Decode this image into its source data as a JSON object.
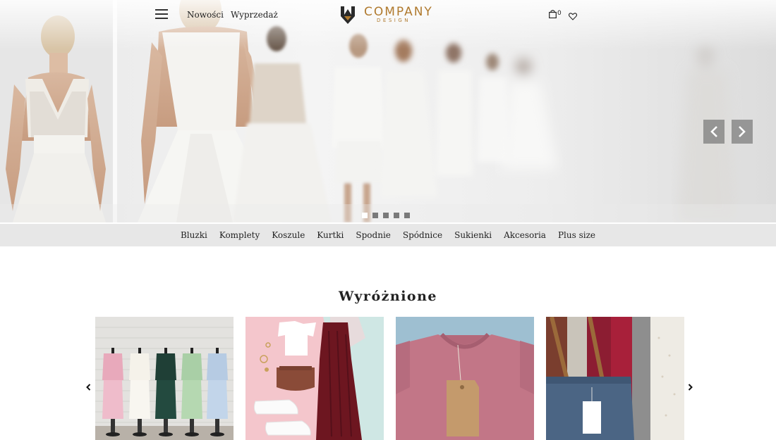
{
  "header": {
    "nav": [
      "Nowości",
      "Wyprzedaż"
    ],
    "logo_main": "COMPANY",
    "logo_sub": "DESIGN",
    "cart_count": "0"
  },
  "hero": {
    "slides_total": 5,
    "active_slide": 1
  },
  "categories": [
    "Bluzki",
    "Komplety",
    "Koszule",
    "Kurtki",
    "Spodnie",
    "Spódnice",
    "Sukienki",
    "Akcesoria",
    "Plus size"
  ],
  "featured": {
    "title": "Wyróżnione",
    "products": [
      {
        "image": "pastel-suits-on-mannequins"
      },
      {
        "image": "white-tee-bag-sneakers-maroon-skirt"
      },
      {
        "image": "pink-tshirt-with-tag"
      },
      {
        "image": "denim-tote-bag-on-clothing-rack"
      }
    ]
  },
  "colors": {
    "brand": "#b07a2e",
    "category_bar": "#e7e7e7",
    "text": "#222222"
  },
  "icons": {
    "menu": "hamburger-icon",
    "cart": "shopping-bag-icon",
    "wishlist": "heart-icon",
    "prev": "chevron-left-icon",
    "next": "chevron-right-icon"
  }
}
